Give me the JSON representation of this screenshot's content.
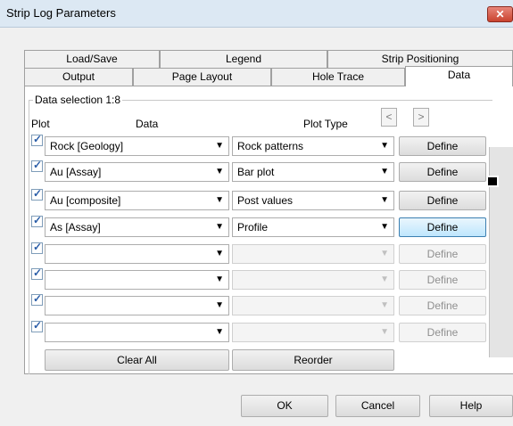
{
  "window": {
    "title": "Strip Log Parameters",
    "close_glyph": "✕"
  },
  "tabs_row1": [
    "Load/Save",
    "Legend",
    "Strip Positioning"
  ],
  "tabs_row2": [
    "Output",
    "Page Layout",
    "Hole Trace",
    "Data"
  ],
  "active_tab": "Data",
  "group_label": "Data selection 1:8",
  "headers": {
    "plot": "Plot",
    "data": "Data",
    "plot_type": "Plot Type"
  },
  "nav": {
    "prev": "<",
    "next": ">"
  },
  "rows": [
    {
      "checked": true,
      "data": "Rock [Geology]",
      "plot_type": "Rock patterns",
      "define": "Define",
      "enabled": true
    },
    {
      "checked": true,
      "data": "Au [Assay]",
      "plot_type": "Bar plot",
      "define": "Define",
      "enabled": true
    },
    {
      "checked": true,
      "data": "Au [composite]",
      "plot_type": "Post values",
      "define": "Define",
      "enabled": true
    },
    {
      "checked": true,
      "data": "As [Assay]",
      "plot_type": "Profile",
      "define": "Define",
      "enabled": true
    },
    {
      "checked": true,
      "data": "",
      "plot_type": "",
      "define": "Define",
      "enabled": false
    },
    {
      "checked": true,
      "data": "",
      "plot_type": "",
      "define": "Define",
      "enabled": false
    },
    {
      "checked": true,
      "data": "",
      "plot_type": "",
      "define": "Define",
      "enabled": false
    },
    {
      "checked": true,
      "data": "",
      "plot_type": "",
      "define": "Define",
      "enabled": false
    }
  ],
  "actions": {
    "clear_all": "Clear All",
    "reorder": "Reorder"
  },
  "footer": {
    "ok": "OK",
    "cancel": "Cancel",
    "help": "Help"
  },
  "icons": {
    "dropdown": "chevron-down-icon",
    "checkbox": "checkmark-icon"
  },
  "colors": {
    "titlebar": "#dce8f3",
    "close": "#c9432f",
    "focus_border": "#3c7fb1"
  }
}
